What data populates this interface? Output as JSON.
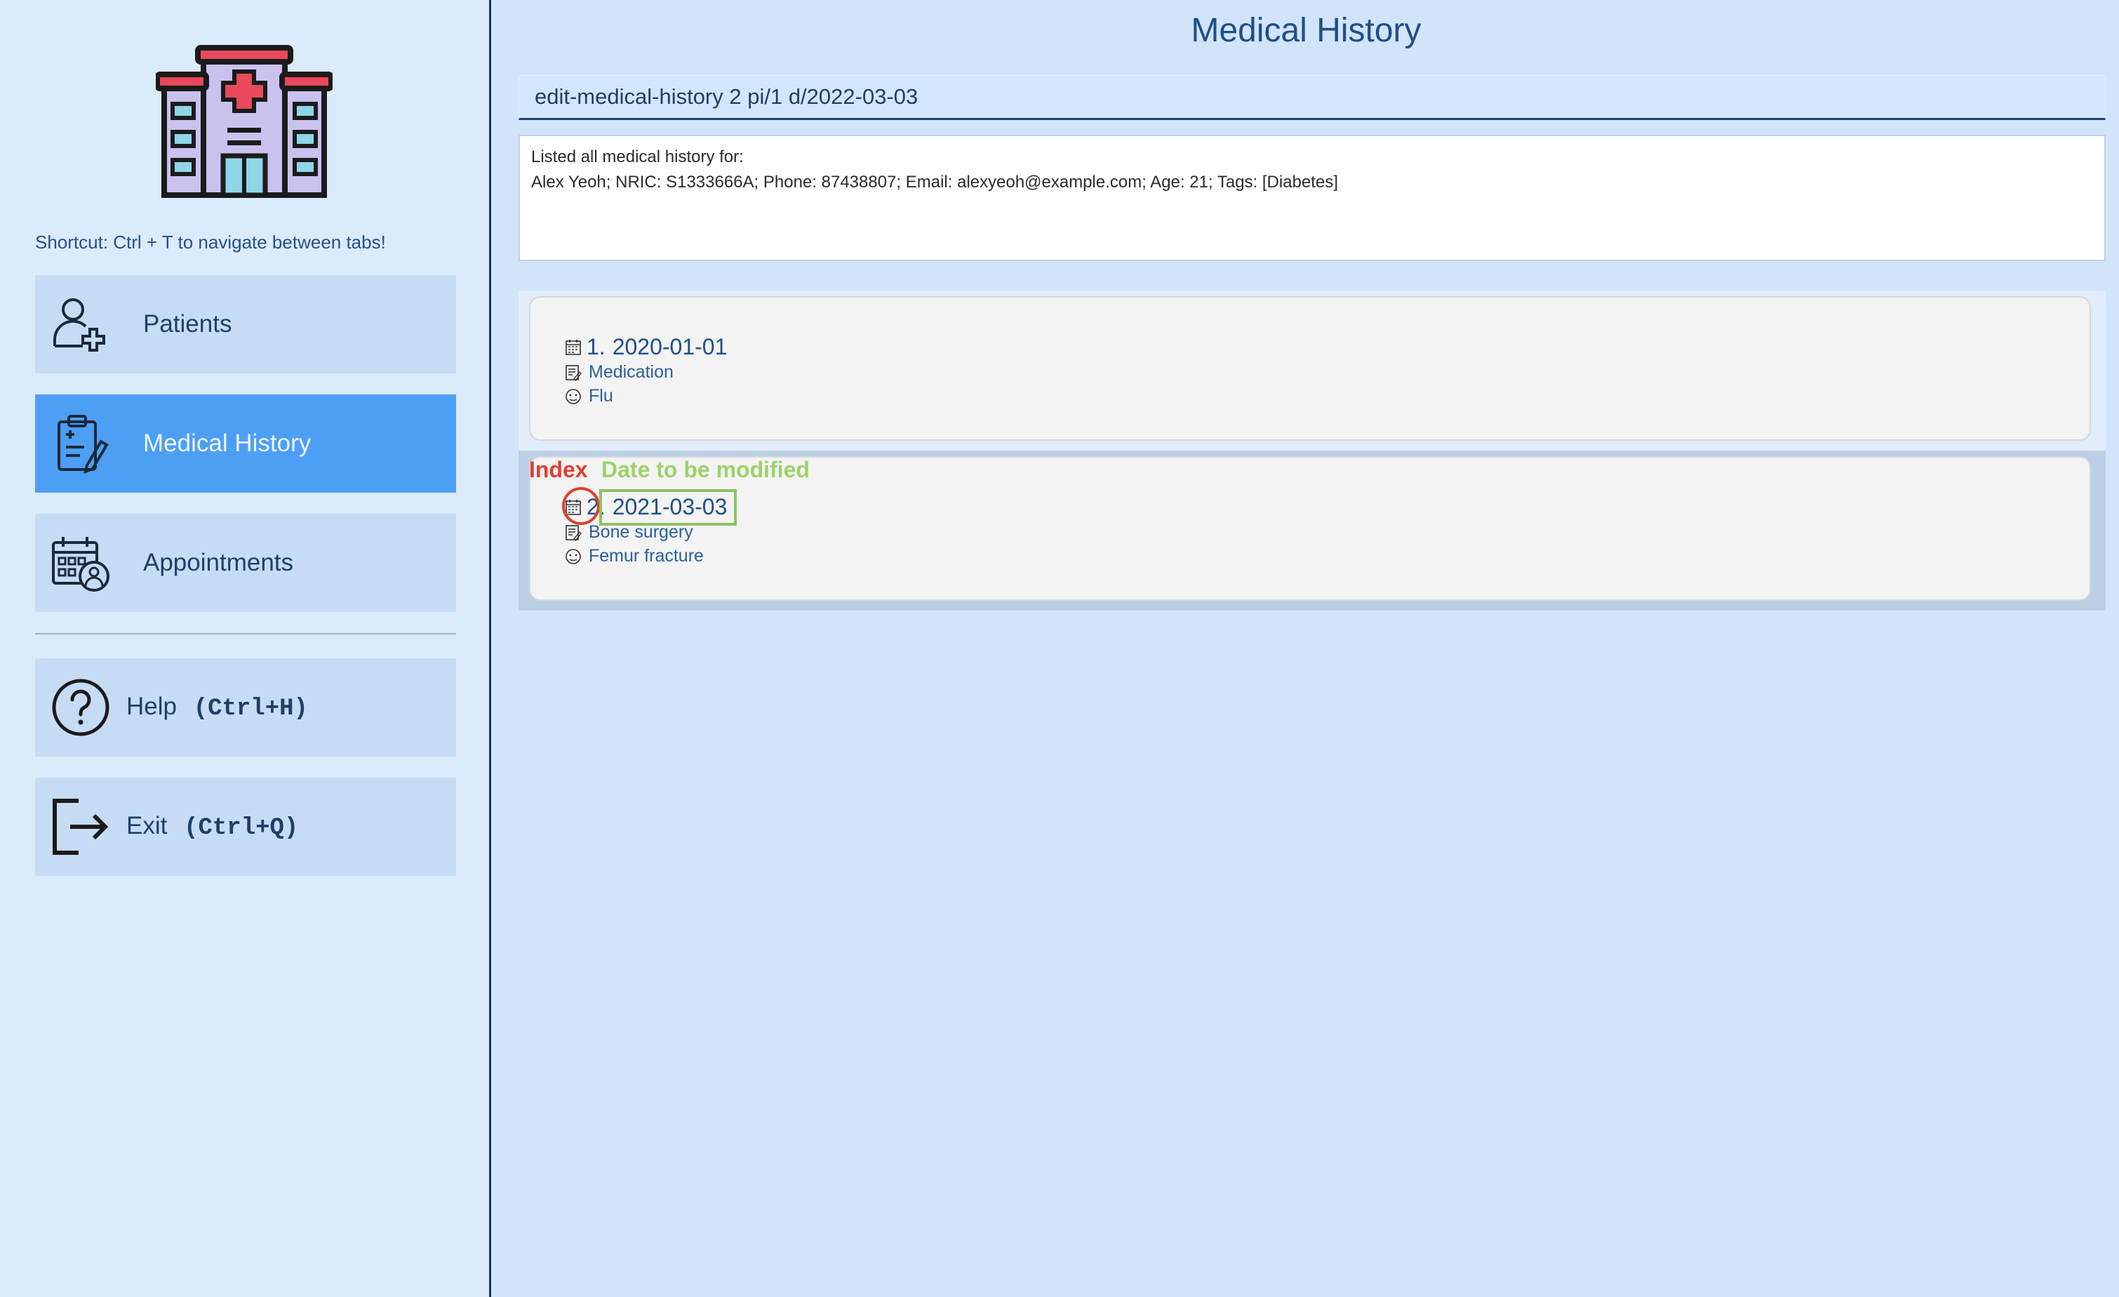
{
  "sidebar": {
    "logo_icon": "hospital-icon",
    "shortcut_hint": "Shortcut: Ctrl + T to navigate between tabs!",
    "tabs": [
      {
        "label": "Patients",
        "icon": "add-patient-icon",
        "active": false
      },
      {
        "label": "Medical History",
        "icon": "clipboard-icon",
        "active": true
      },
      {
        "label": "Appointments",
        "icon": "calendar-doctor-icon",
        "active": false
      }
    ],
    "help": {
      "label": "Help",
      "shortcut": "(Ctrl+H)",
      "icon": "help-icon"
    },
    "exit": {
      "label": "Exit",
      "shortcut": "(Ctrl+Q)",
      "icon": "exit-icon"
    }
  },
  "main": {
    "title": "Medical History",
    "command_value": "edit-medical-history 2 pi/1 d/2022-03-03",
    "result_lines": [
      "Listed all medical history for:",
      "Alex Yeoh; NRIC: S1333666A; Phone: 87438807; Email: alexyeoh@example.com; Age: 21; Tags: [Diabetes]"
    ],
    "records": [
      {
        "index": "1.",
        "date": "2020-01-01",
        "treatment": "Medication",
        "condition": "Flu"
      },
      {
        "index": "2.",
        "date": "2021-03-03",
        "treatment": "Bone surgery",
        "condition": "Femur fracture"
      }
    ],
    "selected_record": 2
  },
  "annotations": {
    "index_label": "Index",
    "date_label": "Date to be modified",
    "index_color": "#e0402f",
    "date_color": "#9ed16a"
  },
  "colors": {
    "background": "#d1e4f9",
    "sidebar": "#dcebfb",
    "nav_button": "#c6dcf5",
    "nav_active": "#4d9ff6",
    "accent_text": "#1f4e89"
  }
}
